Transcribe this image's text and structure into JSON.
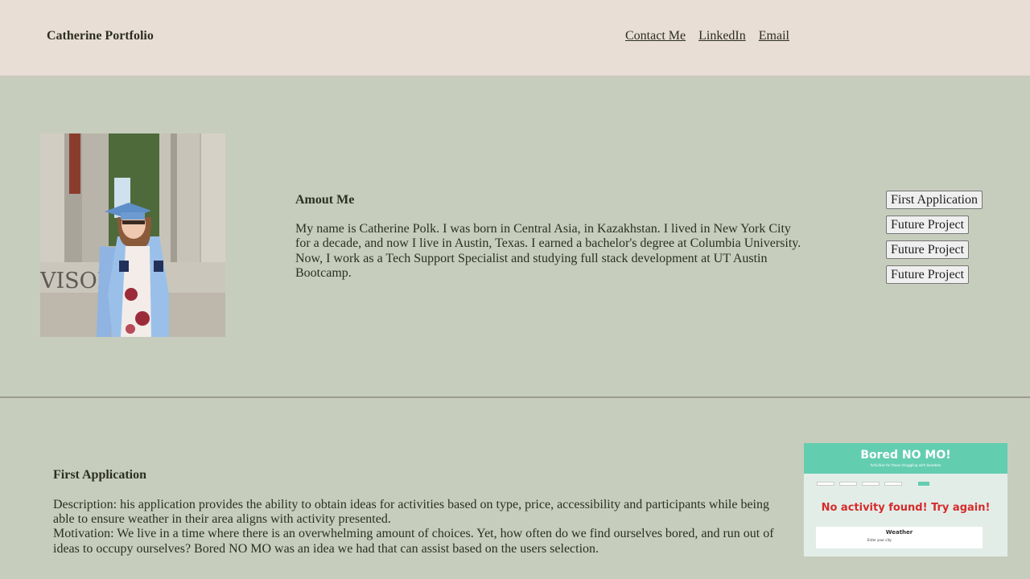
{
  "header": {
    "brand": "Catherine Portfolio",
    "nav": [
      "Contact Me",
      "LinkedIn",
      "Email"
    ]
  },
  "about": {
    "title": "Amout Me",
    "text": "My name is Catherine Polk. I was born in Central Asia, in Kazakhstan. I lived in New York City for a decade, and now I live in Austin, Texas. I earned a bachelor's degree at Columbia University. Now, I work as a Tech Support Specialist and studying full stack development at UT Austin Bootcamp.",
    "photo_engraving": "VISOHN"
  },
  "side_buttons": [
    "First Application",
    "Future Project",
    "Future Project",
    "Future Project"
  ],
  "project": {
    "title": "First Application",
    "description": "Description: his application provides the ability to obtain ideas for activities based on type, price, accessibility and participants while being able to ensure weather in their area aligns with activity presented.",
    "motivation": "Motivation: We live in a time where there is an overwhelming amount of choices. Yet, how often do we find ourselves bored, and run out of ideas to occupy ourselves? Bored NO MO was an idea we had that can assist based on the users selection.",
    "screenshot": {
      "title": "Bored NO MO!",
      "subtitle": "Activities for those struggling with boredom",
      "message": "No activity found! Try again!",
      "weather_title": "Weather",
      "weather_prompt": "Enter your city:"
    }
  },
  "colors": {
    "header_bg": "#e8ded6",
    "page_bg": "#c6cdbc",
    "text": "#2c2f1f",
    "accent_teal": "#63cdb0",
    "alert_red": "#d62b2b"
  }
}
